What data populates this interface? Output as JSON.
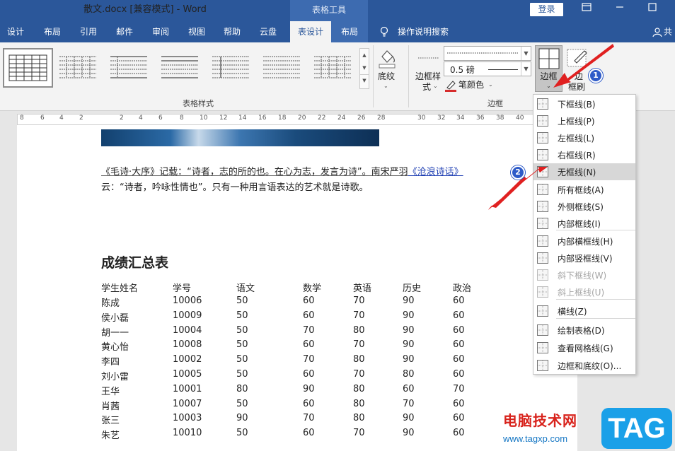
{
  "window": {
    "title": "散文.docx [兼容模式]  -  Word",
    "context_tab_group": "表格工具",
    "login_label": "登录",
    "share_label": "共"
  },
  "tabs": [
    {
      "label": "设计"
    },
    {
      "label": "布局"
    },
    {
      "label": "引用"
    },
    {
      "label": "邮件"
    },
    {
      "label": "审阅"
    },
    {
      "label": "视图"
    },
    {
      "label": "帮助"
    },
    {
      "label": "云盘"
    },
    {
      "label": "表设计"
    },
    {
      "label": "布局"
    }
  ],
  "tell_me": "操作说明搜索",
  "ribbon": {
    "table_styles_group": "表格样式",
    "shading_label": "底纹",
    "border_styles_label": [
      "边框样",
      "式"
    ],
    "pen_weight": "0.5 磅",
    "pen_color_label": "笔颜色",
    "borders_group": "边框",
    "borders_button": "边框",
    "border_painter": [
      "边",
      "框刷"
    ]
  },
  "ruler": {
    "numbers": [
      "8",
      "6",
      "4",
      "2",
      "2",
      "4",
      "6",
      "8",
      "10",
      "12",
      "14",
      "16",
      "18",
      "20",
      "22",
      "24",
      "26",
      "28",
      "30",
      "32",
      "34",
      "36",
      "38",
      "40",
      "42"
    ]
  },
  "document": {
    "para1_quote": "《毛诗·大序》记载：“诗者，志的所的也。在心为志，发言为诗”。南宋严羽",
    "para1_link": "《沧浪诗话》",
    "para2": "云：“诗者，吟咏性情也”。只有一种用言语表达的艺术就是诗歌。",
    "table_title": "成绩汇总表",
    "table_headers": [
      "学生姓名",
      "学号",
      "语文",
      "数学",
      "英语",
      "历史",
      "政治"
    ],
    "table_rows": [
      [
        "陈成",
        "10006",
        "50",
        "60",
        "70",
        "90",
        "60"
      ],
      [
        "侯小磊",
        "10009",
        "50",
        "60",
        "70",
        "90",
        "60"
      ],
      [
        "胡一一",
        "10004",
        "50",
        "70",
        "80",
        "90",
        "60"
      ],
      [
        "黄心怡",
        "10008",
        "50",
        "60",
        "70",
        "90",
        "60"
      ],
      [
        "李四",
        "10002",
        "50",
        "70",
        "80",
        "90",
        "60"
      ],
      [
        "刘小雷",
        "10005",
        "50",
        "60",
        "70",
        "80",
        "60"
      ],
      [
        "王华",
        "10001",
        "80",
        "90",
        "80",
        "60",
        "70"
      ],
      [
        "肖茜",
        "10007",
        "50",
        "60",
        "80",
        "70",
        "60"
      ],
      [
        "张三",
        "10003",
        "90",
        "70",
        "80",
        "90",
        "60"
      ],
      [
        "朱艺",
        "10010",
        "50",
        "60",
        "70",
        "90",
        "60"
      ]
    ]
  },
  "border_menu": {
    "items": [
      {
        "label": "下框线(B)",
        "enabled": true
      },
      {
        "label": "上框线(P)",
        "enabled": true
      },
      {
        "label": "左框线(L)",
        "enabled": true
      },
      {
        "label": "右框线(R)",
        "enabled": true
      },
      {
        "label": "无框线(N)",
        "enabled": true,
        "highlighted": true
      },
      {
        "label": "所有框线(A)",
        "enabled": true
      },
      {
        "label": "外侧框线(S)",
        "enabled": true
      },
      {
        "label": "内部框线(I)",
        "enabled": true
      },
      {
        "label": "内部横框线(H)",
        "enabled": true
      },
      {
        "label": "内部竖框线(V)",
        "enabled": true
      },
      {
        "label": "斜下框线(W)",
        "enabled": false
      },
      {
        "label": "斜上框线(U)",
        "enabled": false
      },
      {
        "label": "横线(Z)",
        "enabled": true
      },
      {
        "label": "绘制表格(D)",
        "enabled": true
      },
      {
        "label": "查看网格线(G)",
        "enabled": true
      },
      {
        "label": "边框和底纹(O)...",
        "enabled": true
      }
    ]
  },
  "annotations": {
    "badge1": "1",
    "badge2": "2"
  },
  "watermark": {
    "text_cn": "电脑技术网",
    "tag": "TAG",
    "url": "www.tagxp.com"
  },
  "colors": {
    "word_blue": "#2b579a",
    "badge_blue": "#2e5bc8",
    "arrow_red": "#e02020",
    "pen_red": "#d62c2c"
  }
}
